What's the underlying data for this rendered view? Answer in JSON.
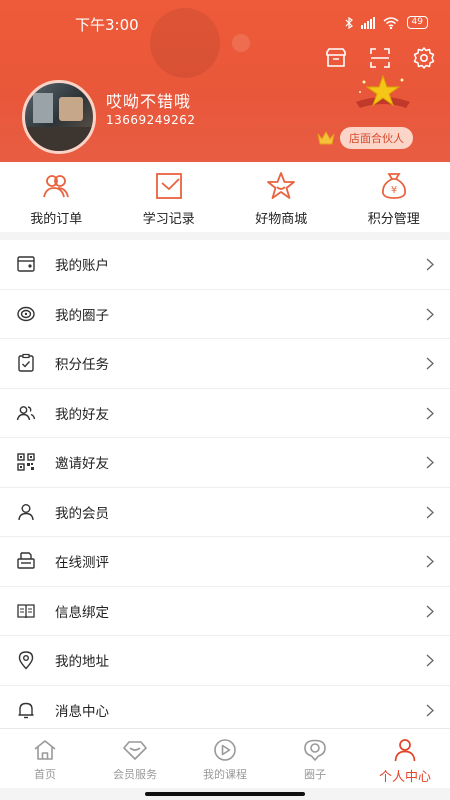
{
  "status": {
    "time": "下午3:00",
    "battery": "49"
  },
  "profile": {
    "name": "哎呦不错哦",
    "phone": "13669249262",
    "partner_label": "店面合伙人"
  },
  "header_icons": [
    "store-icon",
    "scan-icon",
    "settings-icon"
  ],
  "quick_actions": [
    {
      "label": "我的订单",
      "icon": "orders-icon"
    },
    {
      "label": "学习记录",
      "icon": "study-record-icon"
    },
    {
      "label": "好物商城",
      "icon": "mall-icon"
    },
    {
      "label": "积分管理",
      "icon": "points-icon"
    }
  ],
  "menu": [
    {
      "label": "我的账户",
      "icon": "wallet-icon"
    },
    {
      "label": "我的圈子",
      "icon": "circle-icon"
    },
    {
      "label": "积分任务",
      "icon": "clipboard-icon"
    },
    {
      "label": "我的好友",
      "icon": "friends-icon"
    },
    {
      "label": "邀请好友",
      "icon": "qrcode-icon"
    },
    {
      "label": "我的会员",
      "icon": "member-icon"
    },
    {
      "label": "在线测评",
      "icon": "printer-icon"
    },
    {
      "label": "信息绑定",
      "icon": "book-icon"
    },
    {
      "label": "我的地址",
      "icon": "location-icon"
    },
    {
      "label": "消息中心",
      "icon": "bell-icon"
    }
  ],
  "tabs": [
    {
      "label": "首页",
      "icon": "home-icon",
      "active": false
    },
    {
      "label": "会员服务",
      "icon": "diamond-icon",
      "active": false
    },
    {
      "label": "我的课程",
      "icon": "play-icon",
      "active": false
    },
    {
      "label": "圈子",
      "icon": "chat-circle-icon",
      "active": false
    },
    {
      "label": "个人中心",
      "icon": "person-icon",
      "active": true
    }
  ],
  "colors": {
    "accent": "#e9573a",
    "tab_active": "#e2452a",
    "icon_orange": "#e8633f"
  }
}
